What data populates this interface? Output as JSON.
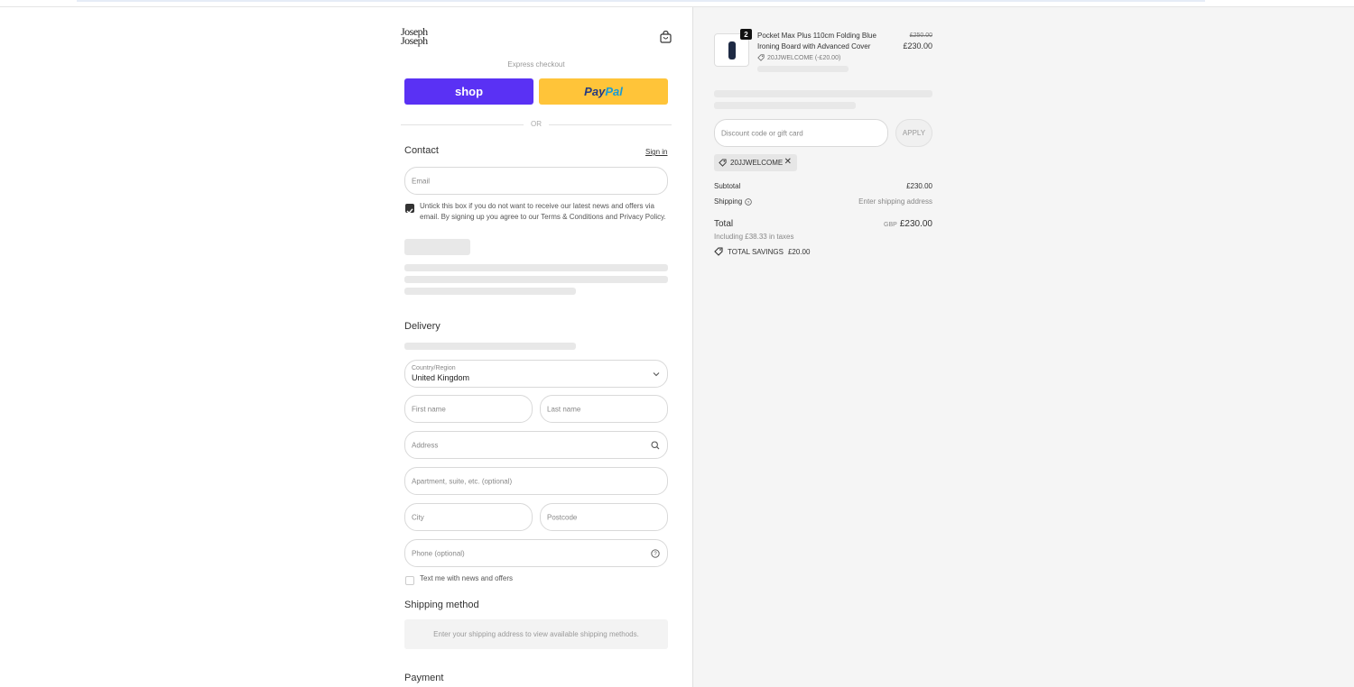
{
  "brand": {
    "line1": "Joseph",
    "line2": "Joseph"
  },
  "express": {
    "label": "Express checkout",
    "shop_label": "shop",
    "paypal_part1": "Pay",
    "paypal_part2": "Pal",
    "or_label": "OR"
  },
  "contact": {
    "title": "Contact",
    "sign_in": "Sign in",
    "email_placeholder": "Email",
    "marketing_text": "Untick this box if you do not want to receive our latest news and offers via email. By signing up you agree to our Terms & Conditions and Privacy Policy.",
    "marketing_checked": true
  },
  "delivery": {
    "title": "Delivery",
    "country_label": "Country/Region",
    "country_value": "United Kingdom",
    "first_name": "First name",
    "last_name": "Last name",
    "address": "Address",
    "apartment": "Apartment, suite, etc. (optional)",
    "city": "City",
    "postcode": "Postcode",
    "phone": "Phone (optional)",
    "sms_text": "Text me with news and offers",
    "sms_checked": false
  },
  "shipping_method": {
    "title": "Shipping method",
    "note": "Enter your shipping address to view available shipping methods."
  },
  "payment": {
    "title": "Payment"
  },
  "cart": {
    "item": {
      "quantity": "2",
      "name": "Pocket Max Plus 110cm Folding Blue Ironing Board with Advanced Cover",
      "discount": "20JJWELCOME (-£20.00)",
      "old_price": "£250.00",
      "price": "£230.00"
    },
    "discount_placeholder": "Discount code or gift card",
    "apply_label": "APPLY",
    "applied_code": "20JJWELCOME",
    "subtotal_label": "Subtotal",
    "subtotal_value": "£230.00",
    "shipping_label": "Shipping",
    "shipping_value": "Enter shipping address",
    "total_label": "Total",
    "currency": "GBP",
    "total_value": "£230.00",
    "tax_note": "Including £38.33 in taxes",
    "savings_label": "TOTAL SAVINGS",
    "savings_value": "£20.00"
  },
  "colors": {
    "shop": "#5a31f4",
    "paypal": "#ffc439",
    "panel": "#f5f5f5"
  }
}
